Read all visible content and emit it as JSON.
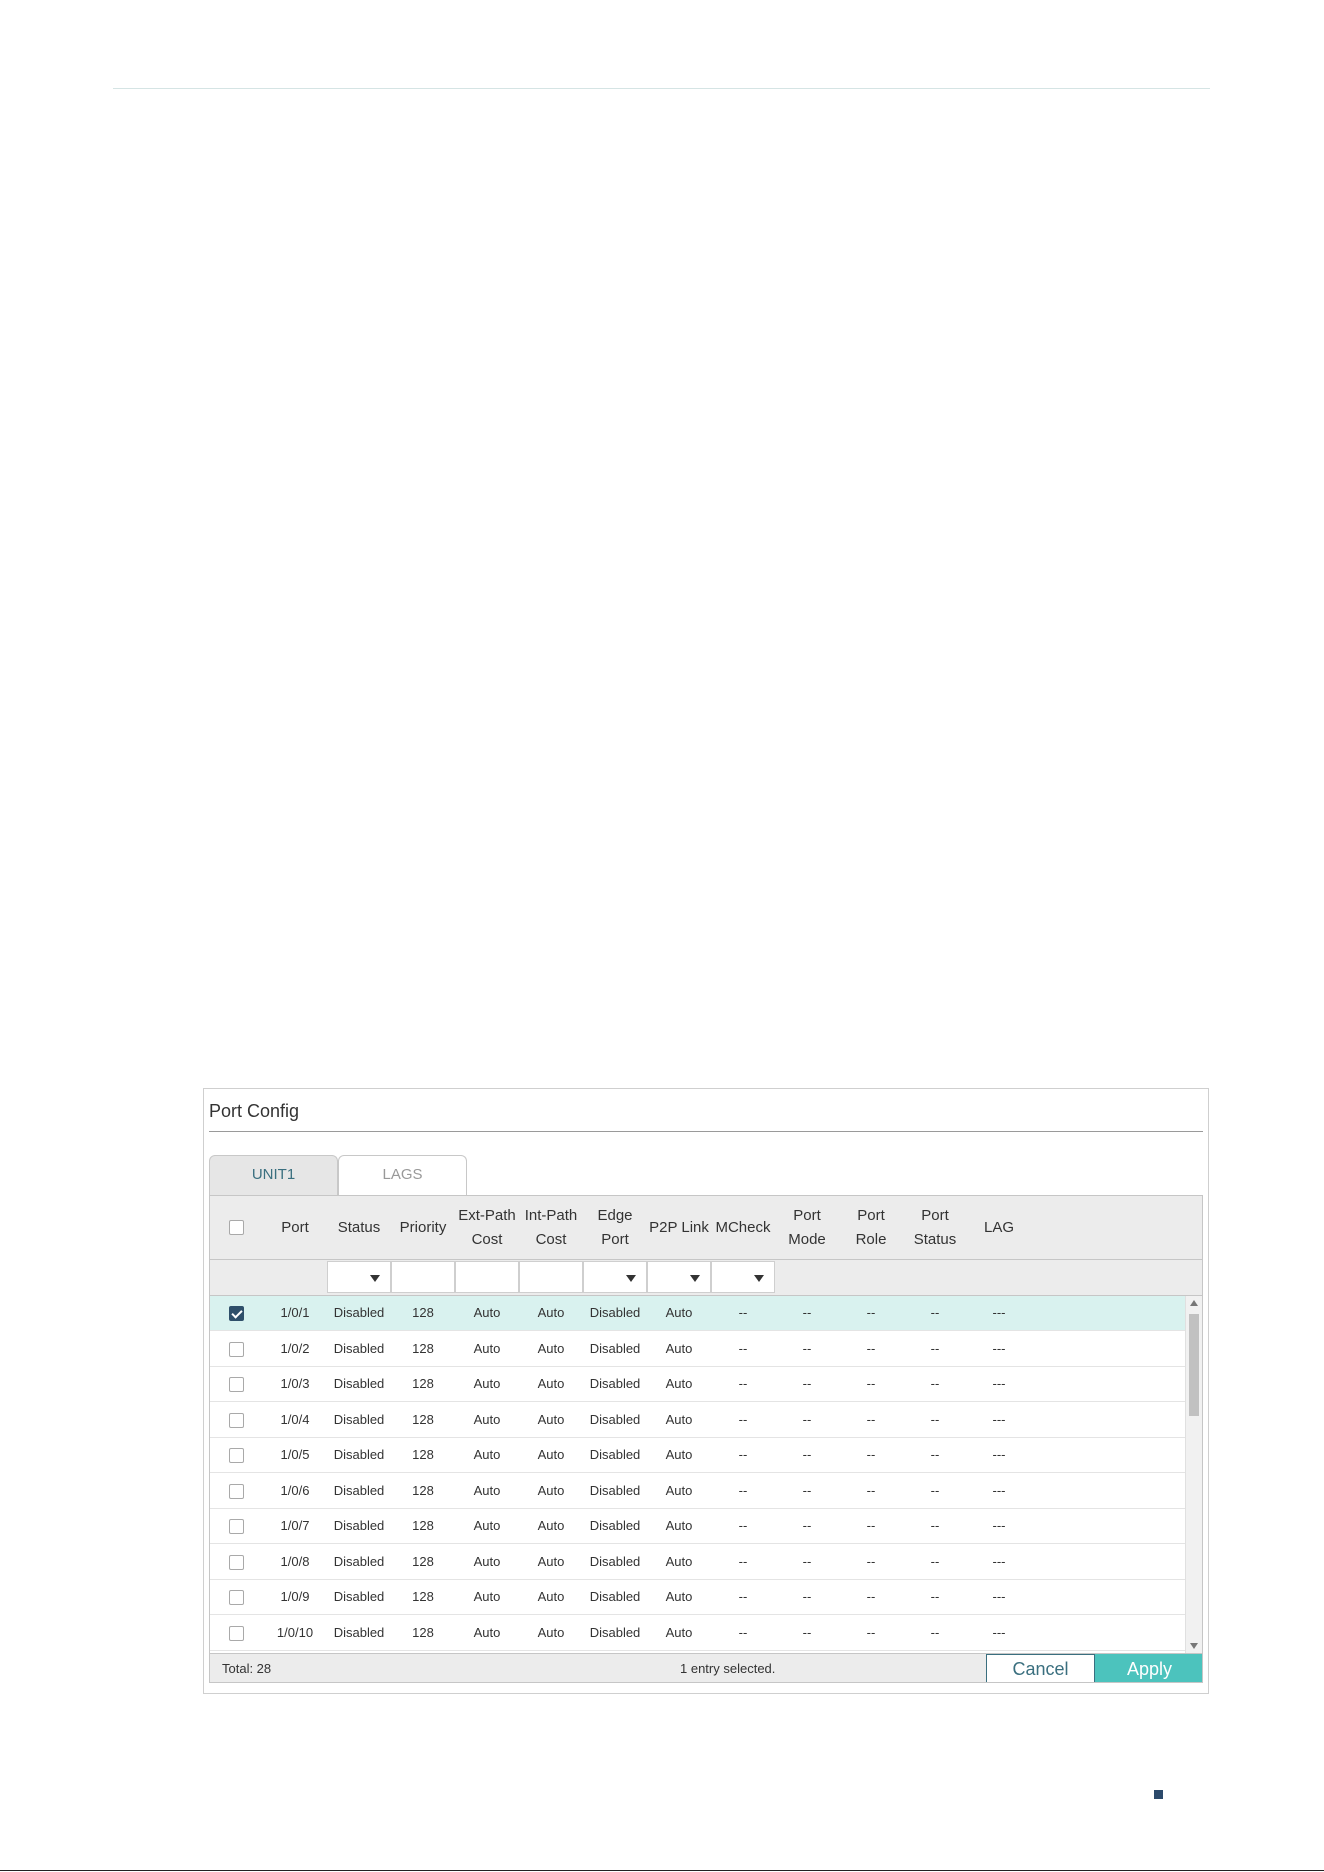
{
  "panel": {
    "title": "Port Config"
  },
  "tabs": [
    {
      "label": "UNIT1",
      "active": true
    },
    {
      "label": "LAGS",
      "active": false
    }
  ],
  "columns": [
    "",
    "Port",
    "Status",
    "Priority",
    "Ext-Path\nCost",
    "Int-Path\nCost",
    "Edge\nPort",
    "P2P Link",
    "MCheck",
    "Port\nMode",
    "Port\nRole",
    "Port\nStatus",
    "LAG"
  ],
  "rows": [
    {
      "checked": true,
      "cells": [
        "1/0/1",
        "Disabled",
        "128",
        "Auto",
        "Auto",
        "Disabled",
        "Auto",
        "--",
        "--",
        "--",
        "--",
        "---"
      ]
    },
    {
      "checked": false,
      "cells": [
        "1/0/2",
        "Disabled",
        "128",
        "Auto",
        "Auto",
        "Disabled",
        "Auto",
        "--",
        "--",
        "--",
        "--",
        "---"
      ]
    },
    {
      "checked": false,
      "cells": [
        "1/0/3",
        "Disabled",
        "128",
        "Auto",
        "Auto",
        "Disabled",
        "Auto",
        "--",
        "--",
        "--",
        "--",
        "---"
      ]
    },
    {
      "checked": false,
      "cells": [
        "1/0/4",
        "Disabled",
        "128",
        "Auto",
        "Auto",
        "Disabled",
        "Auto",
        "--",
        "--",
        "--",
        "--",
        "---"
      ]
    },
    {
      "checked": false,
      "cells": [
        "1/0/5",
        "Disabled",
        "128",
        "Auto",
        "Auto",
        "Disabled",
        "Auto",
        "--",
        "--",
        "--",
        "--",
        "---"
      ]
    },
    {
      "checked": false,
      "cells": [
        "1/0/6",
        "Disabled",
        "128",
        "Auto",
        "Auto",
        "Disabled",
        "Auto",
        "--",
        "--",
        "--",
        "--",
        "---"
      ]
    },
    {
      "checked": false,
      "cells": [
        "1/0/7",
        "Disabled",
        "128",
        "Auto",
        "Auto",
        "Disabled",
        "Auto",
        "--",
        "--",
        "--",
        "--",
        "---"
      ]
    },
    {
      "checked": false,
      "cells": [
        "1/0/8",
        "Disabled",
        "128",
        "Auto",
        "Auto",
        "Disabled",
        "Auto",
        "--",
        "--",
        "--",
        "--",
        "---"
      ]
    },
    {
      "checked": false,
      "cells": [
        "1/0/9",
        "Disabled",
        "128",
        "Auto",
        "Auto",
        "Disabled",
        "Auto",
        "--",
        "--",
        "--",
        "--",
        "---"
      ]
    },
    {
      "checked": false,
      "cells": [
        "1/0/10",
        "Disabled",
        "128",
        "Auto",
        "Auto",
        "Disabled",
        "Auto",
        "--",
        "--",
        "--",
        "--",
        "---"
      ]
    }
  ],
  "footer": {
    "total": "Total: 28",
    "selected": "1 entry selected.",
    "cancel_label": "Cancel",
    "apply_label": "Apply"
  },
  "colors": {
    "accent": "#4cc3bd",
    "selected_row": "#d9f2ef",
    "checkbox_checked": "#2f4f6a"
  }
}
